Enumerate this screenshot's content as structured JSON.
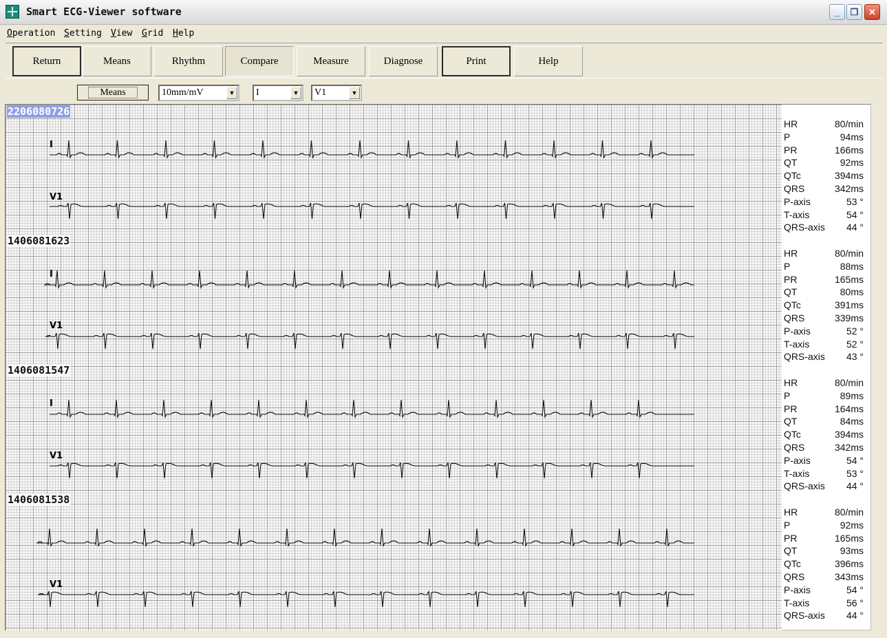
{
  "window": {
    "title": "Smart ECG-Viewer software"
  },
  "menu": [
    "Operation",
    "Setting",
    "View",
    "Grid",
    "Help"
  ],
  "toolbar": [
    "Return",
    "Means",
    "Rhythm",
    "Compare",
    "Measure",
    "Diagnose",
    "Print",
    "Help"
  ],
  "options": {
    "means_label": "Means",
    "gain": "10mm/mV",
    "lead_a": "I",
    "lead_b": "V1"
  },
  "records": [
    {
      "id": "2206080726",
      "leads": [
        "I",
        "V1"
      ],
      "measurements": [
        {
          "k": "HR",
          "v": "80/min"
        },
        {
          "k": "P",
          "v": "94ms"
        },
        {
          "k": "PR",
          "v": "166ms"
        },
        {
          "k": "QT",
          "v": "92ms"
        },
        {
          "k": "QTc",
          "v": "394ms"
        },
        {
          "k": "QRS",
          "v": "342ms"
        },
        {
          "k": "P-axis",
          "v": "53 °"
        },
        {
          "k": "T-axis",
          "v": "54 °"
        },
        {
          "k": "QRS-axis",
          "v": "44 °"
        }
      ]
    },
    {
      "id": "1406081623",
      "leads": [
        "I",
        "V1"
      ],
      "measurements": [
        {
          "k": "HR",
          "v": "80/min"
        },
        {
          "k": "P",
          "v": "88ms"
        },
        {
          "k": "PR",
          "v": "165ms"
        },
        {
          "k": "QT",
          "v": "80ms"
        },
        {
          "k": "QTc",
          "v": "391ms"
        },
        {
          "k": "QRS",
          "v": "339ms"
        },
        {
          "k": "P-axis",
          "v": "52 °"
        },
        {
          "k": "T-axis",
          "v": "52 °"
        },
        {
          "k": "QRS-axis",
          "v": "43 °"
        }
      ]
    },
    {
      "id": "1406081547",
      "leads": [
        "I",
        "V1"
      ],
      "measurements": [
        {
          "k": "HR",
          "v": "80/min"
        },
        {
          "k": "P",
          "v": "89ms"
        },
        {
          "k": "PR",
          "v": "164ms"
        },
        {
          "k": "QT",
          "v": "84ms"
        },
        {
          "k": "QTc",
          "v": "394ms"
        },
        {
          "k": "QRS",
          "v": "342ms"
        },
        {
          "k": "P-axis",
          "v": "54 °"
        },
        {
          "k": "T-axis",
          "v": "53 °"
        },
        {
          "k": "QRS-axis",
          "v": "44 °"
        }
      ]
    },
    {
      "id": "1406081538",
      "leads": [
        "",
        "V1"
      ],
      "measurements": [
        {
          "k": "HR",
          "v": "80/min"
        },
        {
          "k": "P",
          "v": "92ms"
        },
        {
          "k": "PR",
          "v": "165ms"
        },
        {
          "k": "QT",
          "v": "93ms"
        },
        {
          "k": "QTc",
          "v": "396ms"
        },
        {
          "k": "QRS",
          "v": "343ms"
        },
        {
          "k": "P-axis",
          "v": "54 °"
        },
        {
          "k": "T-axis",
          "v": "56 °"
        },
        {
          "k": "QRS-axis",
          "v": "44 °"
        }
      ]
    }
  ]
}
